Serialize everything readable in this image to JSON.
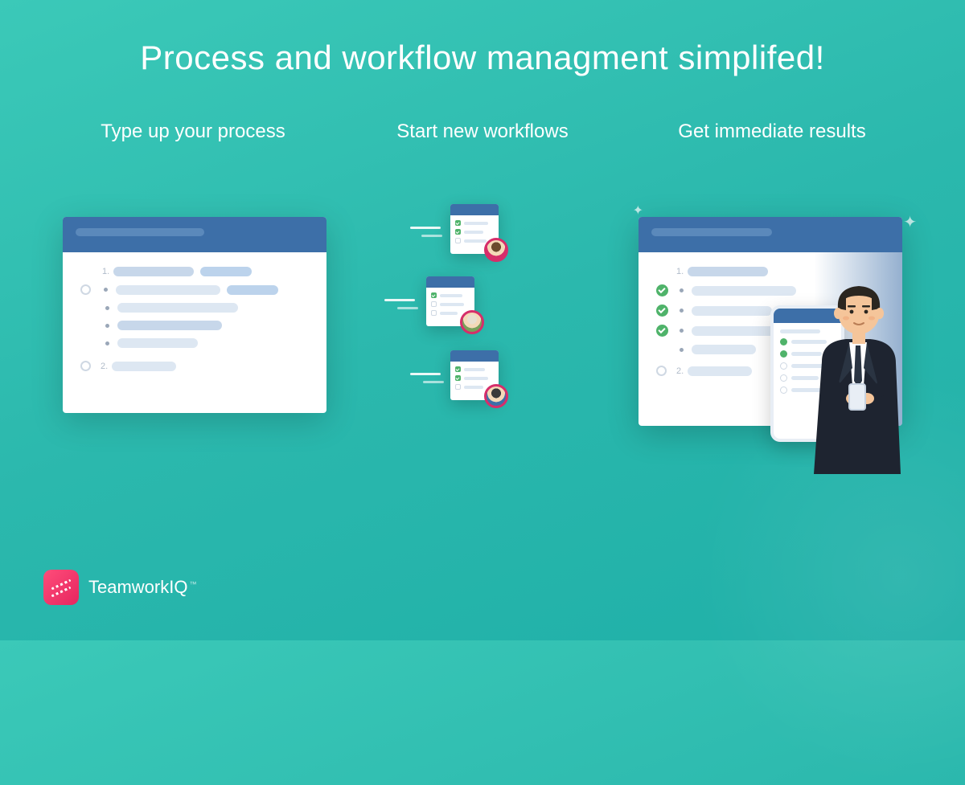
{
  "headline": "Process and workflow managment simplifed!",
  "columns": [
    {
      "title": "Type up your process"
    },
    {
      "title": "Start new workflows"
    },
    {
      "title": "Get immediate results"
    }
  ],
  "list_numbers": {
    "one": "1.",
    "two": "2."
  },
  "brand": {
    "name_part1": "Teamwork",
    "name_part2": "IQ",
    "tm": "™"
  },
  "colors": {
    "bg_teal": "#2bb8ad",
    "card_header": "#3d6fa8",
    "accent_pink": "#e6255f",
    "check_green": "#4fb36a"
  }
}
